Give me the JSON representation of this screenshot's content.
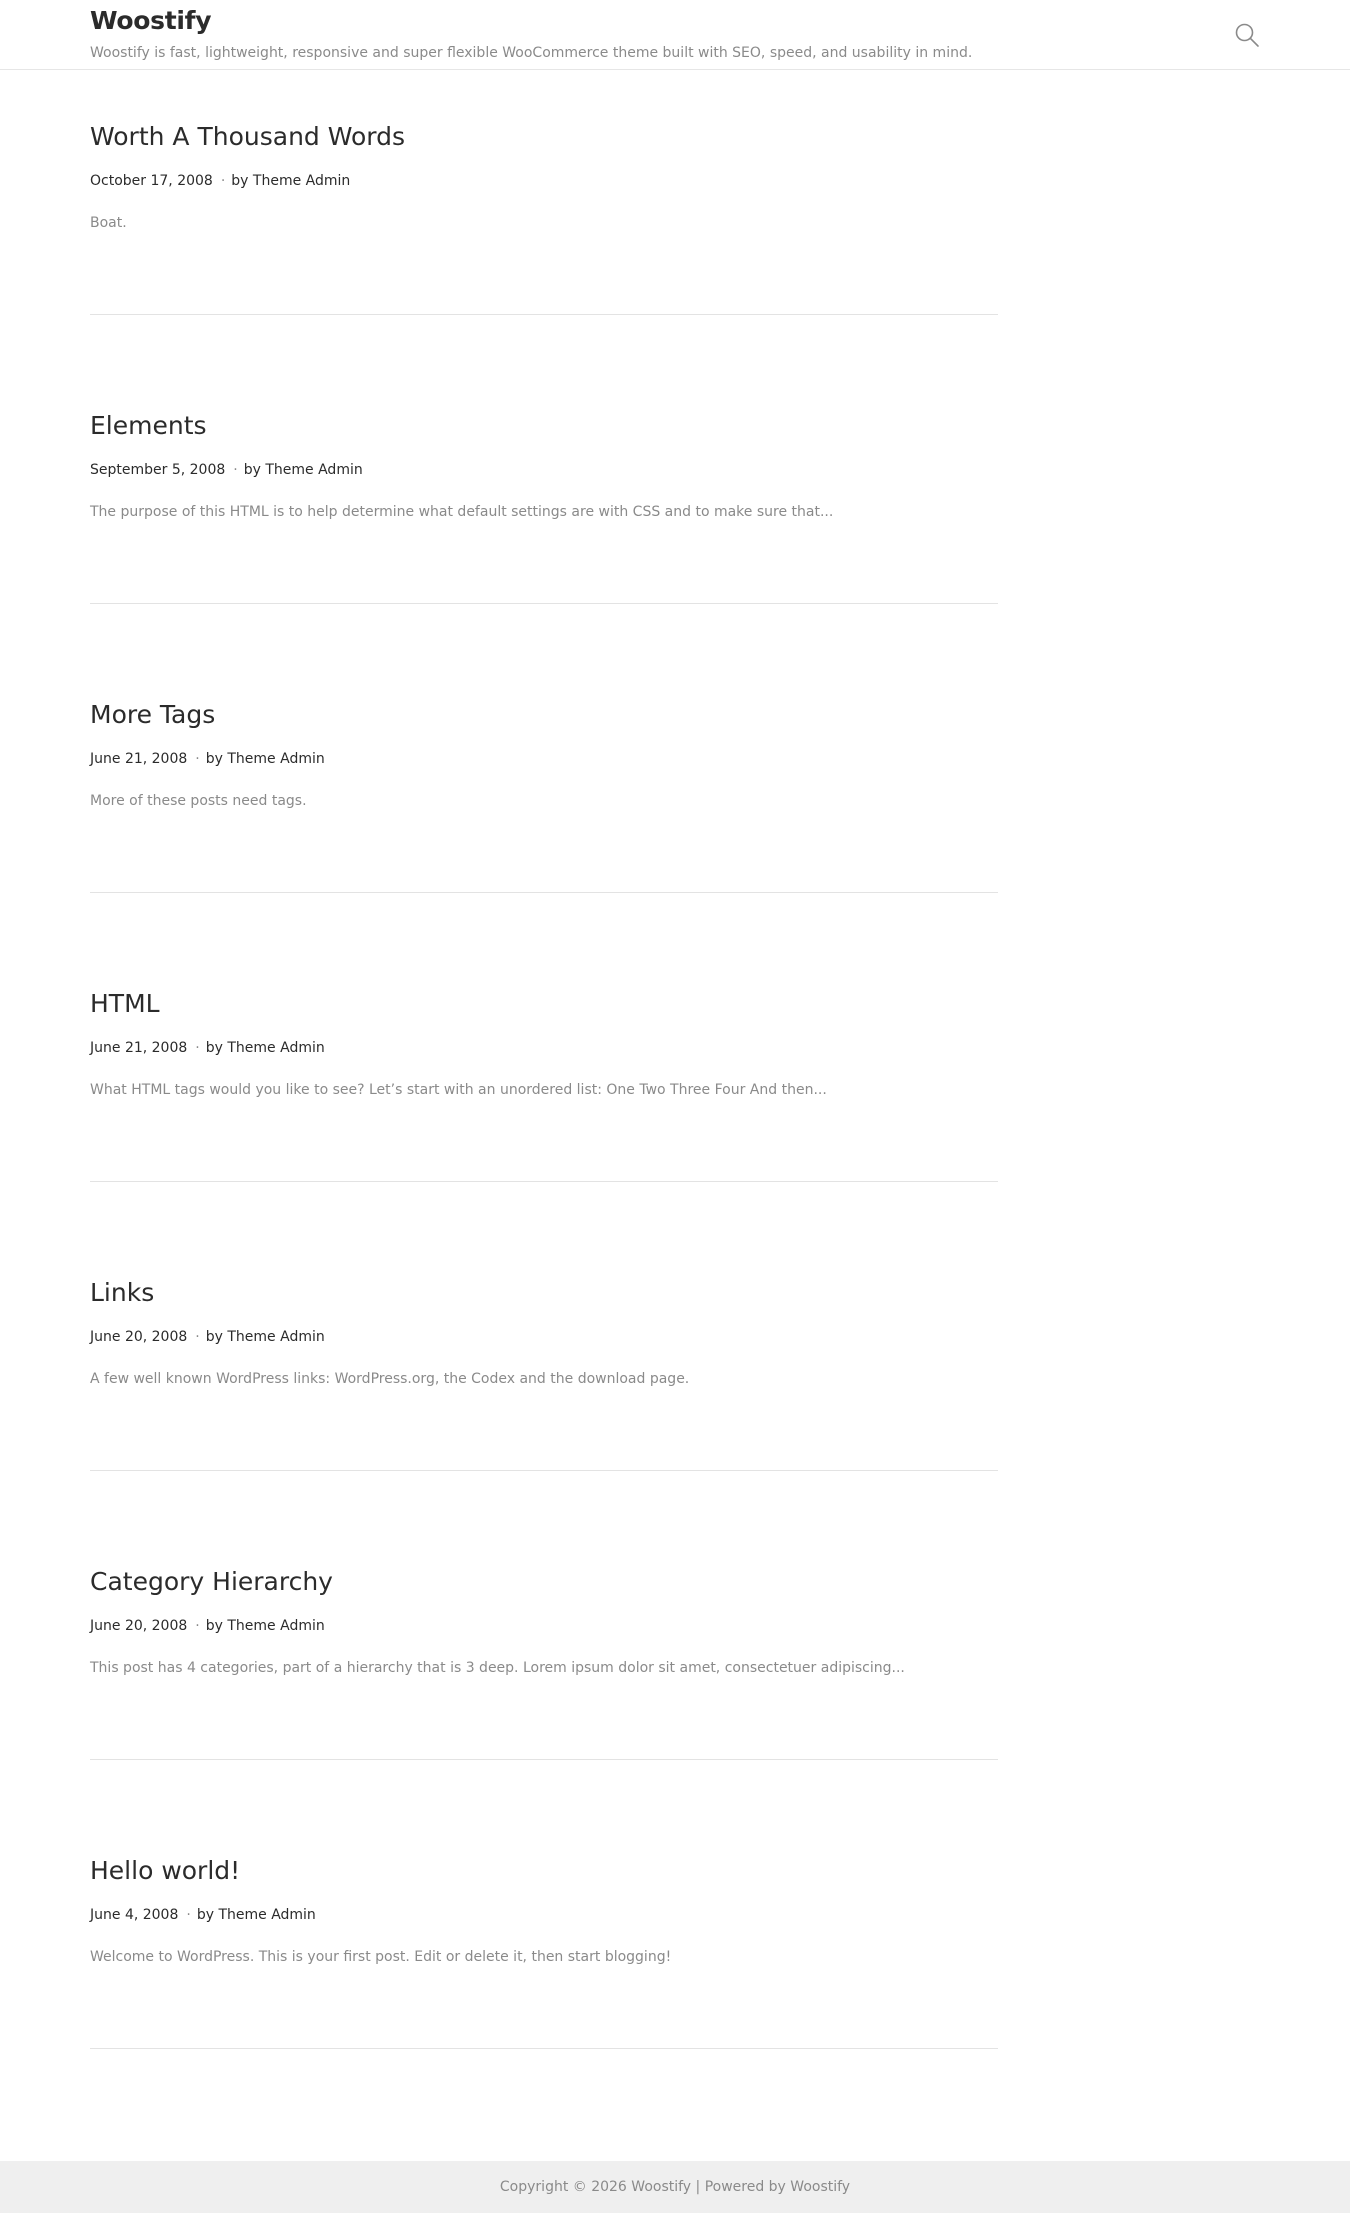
{
  "header": {
    "site_title": "Woostify",
    "tagline": "Woostify is fast, lightweight, responsive and super flexible WooCommerce theme built with SEO, speed, and usability in mind.",
    "search_icon": "search-icon"
  },
  "posts": [
    {
      "title": "Worth A Thousand Words",
      "date": "October 17, 2008",
      "separator": "·",
      "author": "by Theme Admin",
      "excerpt": "Boat."
    },
    {
      "title": "Elements",
      "date": "September 5, 2008",
      "separator": "·",
      "author": "by Theme Admin",
      "excerpt": "The purpose of this HTML is to help determine what default settings are with CSS and to make sure that..."
    },
    {
      "title": "More Tags",
      "date": "June 21, 2008",
      "separator": "·",
      "author": "by Theme Admin",
      "excerpt": "More of these posts need tags."
    },
    {
      "title": "HTML",
      "date": "June 21, 2008",
      "separator": "·",
      "author": "by Theme Admin",
      "excerpt": "What HTML tags would you like to see? Let’s start with an unordered list: One Two Three Four And then..."
    },
    {
      "title": "Links",
      "date": "June 20, 2008",
      "separator": "·",
      "author": "by Theme Admin",
      "excerpt": "A few well known WordPress links: WordPress.org, the Codex and the download page."
    },
    {
      "title": "Category Hierarchy",
      "date": "June 20, 2008",
      "separator": "·",
      "author": "by Theme Admin",
      "excerpt": "This post has 4 categories, part of a hierarchy that is 3 deep. Lorem ipsum dolor sit amet, consectetuer adipiscing..."
    },
    {
      "title": "Hello world!",
      "date": "June 4, 2008",
      "separator": "·",
      "author": "by Theme Admin",
      "excerpt": "Welcome to WordPress. This is your first post. Edit or delete it, then start blogging!"
    }
  ],
  "footer": {
    "copyright": "Copyright © 2026 Woostify | Powered by Woostify"
  }
}
